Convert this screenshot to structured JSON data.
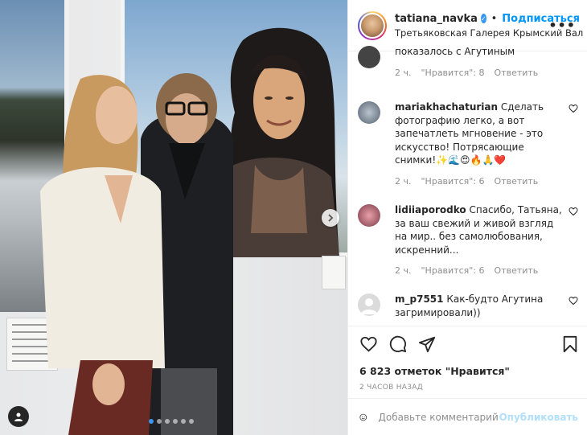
{
  "header": {
    "username": "tatiana_navka",
    "bullet": "•",
    "follow_label": "Подписаться",
    "location": "Третьяковская Галерея Крымский Вал",
    "more_label": "•••"
  },
  "comments": [
    {
      "user": "",
      "text": "показалось с Агутиным",
      "time": "2 ч.",
      "likes": "\"Нравится\": 8",
      "reply": "Ответить"
    },
    {
      "user": "mariakhachaturian",
      "text": "Сделать фотографию легко, а вот запечатлеть мгновение - это искусство! Потрясающие снимки!✨🌊😍🔥🙏❤️",
      "time": "2 ч.",
      "likes": "\"Нравится\": 6",
      "reply": "Ответить"
    },
    {
      "user": "lidiiaporodko",
      "text": "Спасибо, Татьяна, за ваш свежий и живой взгляд на мир.. без самолюбования, искренний...",
      "time": "2 ч.",
      "likes": "\"Нравится\": 6",
      "reply": "Ответить"
    },
    {
      "user": "m_p7551",
      "text": "Как-будто Агутина загримировали))",
      "time": "",
      "likes": "",
      "reply": ""
    }
  ],
  "likes_text": "6 823 отметок \"Нравится\"",
  "time_ago": "2 ЧАСОВ НАЗАД",
  "add_comment": {
    "placeholder": "Добавьте комментарий...",
    "post_label": "Опубликовать"
  },
  "colors": {
    "accent": "#0095f6",
    "post_disabled": "#b2dffc",
    "muted": "#8e8e8e",
    "verified": "#3897f0"
  },
  "icons": [
    "heart-icon",
    "comment-icon",
    "share-icon",
    "bookmark-icon",
    "emoji-icon",
    "chevron-right-icon",
    "user-tag-icon",
    "more-icon"
  ]
}
